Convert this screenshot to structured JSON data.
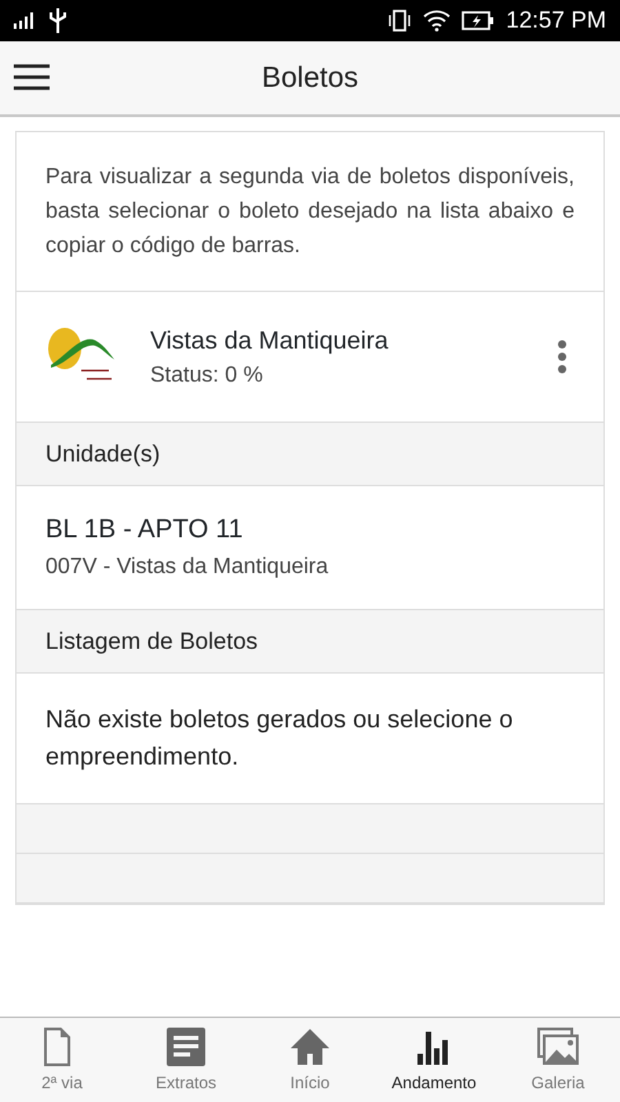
{
  "status_bar": {
    "time": "12:57 PM"
  },
  "app_bar": {
    "title": "Boletos"
  },
  "intro": "Para visualizar a segunda via de boletos disponíveis, basta selecionar o boleto desejado na lista abaixo e copiar o código de barras.",
  "project": {
    "name": "Vistas da Mantiqueira",
    "status": "Status: 0 %"
  },
  "units_header": "Unidade(s)",
  "units": [
    {
      "title": "BL 1B - APTO 11",
      "subtitle": "007V - Vistas da Mantiqueira"
    }
  ],
  "boletos_header": "Listagem de Boletos",
  "boletos_message": "Não existe boletos gerados ou selecione o empreendimento.",
  "empty_rows": [
    {
      "kind": "blank"
    },
    {
      "kind": "blank"
    }
  ],
  "tabs": [
    {
      "label": "2ª via",
      "kind": "file",
      "selected": false
    },
    {
      "label": "Extratos",
      "kind": "list",
      "selected": false
    },
    {
      "label": "Início",
      "kind": "home",
      "selected": false
    },
    {
      "label": "Andamento",
      "kind": "bars",
      "selected": true
    },
    {
      "label": "Galeria",
      "kind": "gallery",
      "selected": false
    }
  ]
}
